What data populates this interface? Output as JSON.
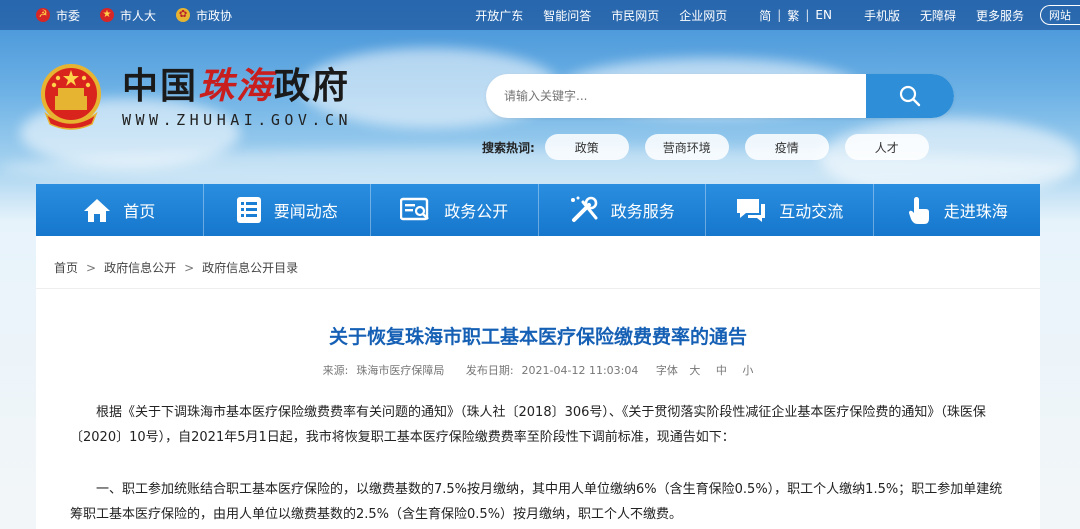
{
  "topbar": {
    "left": [
      {
        "label": "市委",
        "icon": "party-emblem-icon"
      },
      {
        "label": "市人大",
        "icon": "national-emblem-icon"
      },
      {
        "label": "市政协",
        "icon": "cppcc-emblem-icon"
      }
    ],
    "links": [
      "开放广东",
      "智能问答",
      "市民网页",
      "企业网页"
    ],
    "lang": {
      "simplified": "简",
      "traditional": "繁",
      "english": "EN"
    },
    "right_links": [
      "手机版",
      "无障碍",
      "更多服务"
    ],
    "corner_badge": "网站"
  },
  "header": {
    "title_prefix": "中国",
    "title_red": "珠海",
    "title_suffix": "政府",
    "url": "WWW.ZHUHAI.GOV.CN"
  },
  "search": {
    "placeholder": "请输入关键字...",
    "hot_label": "搜索热词:",
    "hot_tags": [
      "政策",
      "营商环境",
      "疫情",
      "人才"
    ]
  },
  "nav": [
    {
      "label": "首页",
      "icon": "home-icon"
    },
    {
      "label": "要闻动态",
      "icon": "news-list-icon"
    },
    {
      "label": "政务公开",
      "icon": "document-search-icon"
    },
    {
      "label": "政务服务",
      "icon": "tools-icon"
    },
    {
      "label": "互动交流",
      "icon": "chat-icon"
    },
    {
      "label": "走进珠海",
      "icon": "hand-pointer-icon"
    }
  ],
  "breadcrumb": [
    "首页",
    "政府信息公开",
    "政府信息公开目录"
  ],
  "article": {
    "title": "关于恢复珠海市职工基本医疗保险缴费费率的通告",
    "source_label": "来源:",
    "source": "珠海市医疗保障局",
    "date_label": "发布日期:",
    "date": "2021-04-12 11:03:04",
    "font_label": "字体",
    "font_large": "大",
    "font_medium": "中",
    "font_small": "小",
    "paragraphs": [
      "根据《关于下调珠海市基本医疗保险缴费费率有关问题的通知》（珠人社〔2018〕306号）、《关于贯彻落实阶段性减征企业基本医疗保险费的通知》（珠医保〔2020〕10号），自2021年5月1日起，我市将恢复职工基本医疗保险缴费费率至阶段性下调前标准，现通告如下：",
      "一、职工参加统账结合职工基本医疗保险的，以缴费基数的7.5%按月缴纳，其中用人单位缴纳6%（含生育保险0.5%），职工个人缴纳1.5%；职工参加单建统筹职工基本医疗保险的，由用人单位以缴费基数的2.5%（含生育保险0.5%）按月缴纳，职工个人不缴费。"
    ]
  },
  "colors": {
    "nav_blue": "#1677cc",
    "title_blue": "#1560b5",
    "logo_red": "#c81e1e",
    "search_button": "#2e8fd8"
  }
}
